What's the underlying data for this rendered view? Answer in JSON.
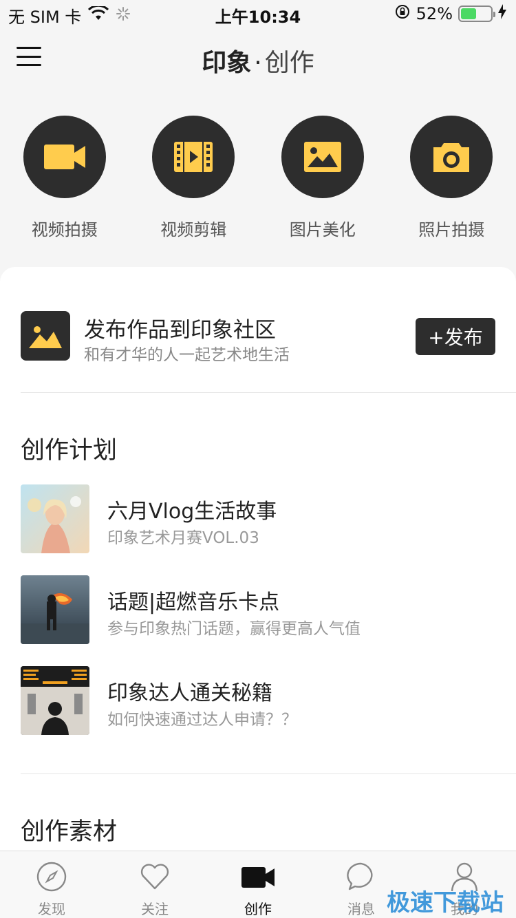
{
  "status_bar": {
    "carrier": "无 SIM 卡",
    "time": "上午10:34",
    "battery_percent": "52%",
    "battery_level": 0.52
  },
  "nav": {
    "title_bold": "印象",
    "title_dot": "·",
    "title_light": "创作"
  },
  "tools": [
    {
      "label": "视频拍摄",
      "icon": "video-camera-icon"
    },
    {
      "label": "视频剪辑",
      "icon": "film-icon"
    },
    {
      "label": "图片美化",
      "icon": "image-icon"
    },
    {
      "label": "照片拍摄",
      "icon": "camera-icon"
    }
  ],
  "publish": {
    "title": "发布作品到印象社区",
    "subtitle": "和有才华的人一起艺术地生活",
    "button": "+发布"
  },
  "plan": {
    "section_title": "创作计划",
    "items": [
      {
        "title": "六月Vlog生活故事",
        "subtitle": "印象艺术月赛VOL.03"
      },
      {
        "title": "话题|超燃音乐卡点",
        "subtitle": "参与印象热门话题，赢得更高人气值"
      },
      {
        "title": "印象达人通关秘籍",
        "subtitle": "如何快速通过达人申请？？"
      }
    ]
  },
  "materials": {
    "section_title": "创作素材"
  },
  "tab_bar": {
    "tabs": [
      {
        "label": "发现",
        "icon": "compass-icon"
      },
      {
        "label": "关注",
        "icon": "heart-icon"
      },
      {
        "label": "创作",
        "icon": "video-camera-icon",
        "active": true
      },
      {
        "label": "消息",
        "icon": "chat-bubble-icon"
      },
      {
        "label": "我的",
        "icon": "person-icon"
      }
    ]
  },
  "watermark": "极速下载站",
  "colors": {
    "accent": "#ffcc4d",
    "dark": "#2d2d2d",
    "battery": "#4cd964"
  }
}
